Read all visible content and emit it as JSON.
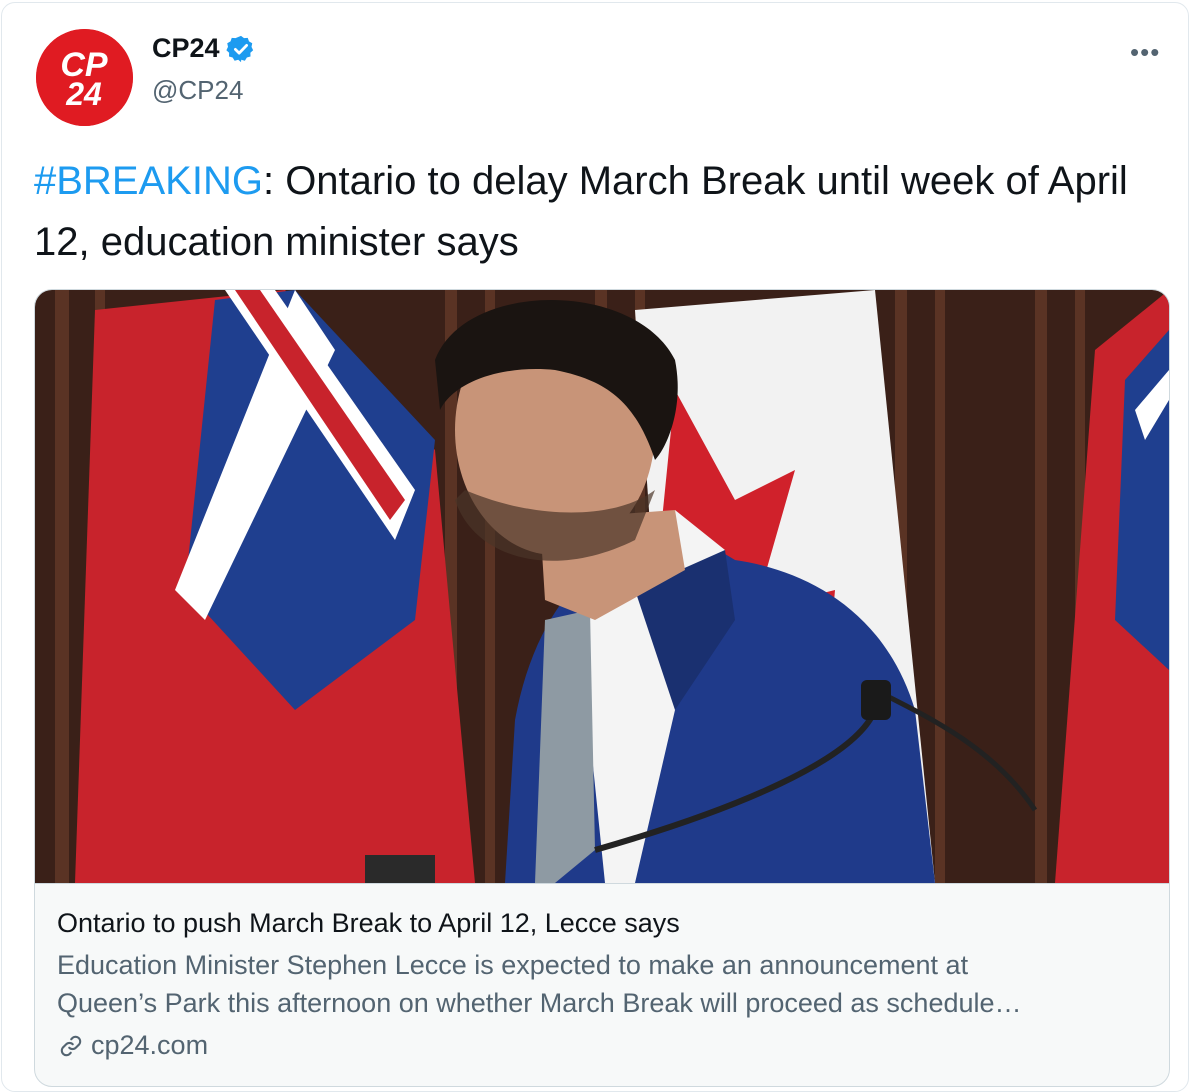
{
  "account": {
    "name": "CP24",
    "handle": "@CP24",
    "avatar_logo_text": [
      "CP",
      "24"
    ],
    "verified": true
  },
  "more_label": "•••",
  "tweet": {
    "hashtag": "#BREAKING",
    "body_rest": ": Ontario to delay March Break until week of April 12, education minister says"
  },
  "card": {
    "title": "Ontario to push March Break to April 12, Lecce says",
    "description_line1": "Education Minister Stephen Lecce is expected to make an announcement at",
    "description_line2": "Queen’s Park this afternoon on whether March Break will proceed as schedule…",
    "domain": "cp24.com"
  },
  "colors": {
    "brand_red": "#e01b22",
    "link_blue": "#1d9bf0",
    "verified_blue": "#1d9bf0",
    "muted_text": "#536471"
  },
  "icons": {
    "verified": "verified-badge-icon",
    "more": "more-options-icon",
    "link": "link-icon"
  }
}
